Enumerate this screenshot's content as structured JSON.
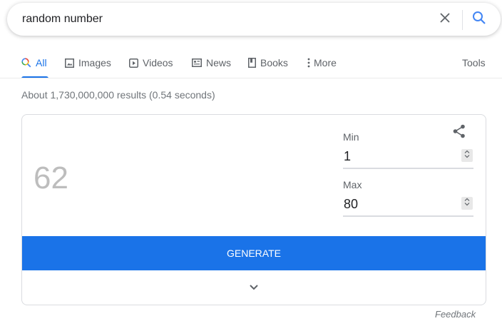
{
  "search": {
    "query": "random number",
    "clear_icon": "close-icon",
    "search_icon": "search-icon"
  },
  "tabs": [
    {
      "label": "All",
      "icon": "search-multicolor-icon",
      "active": true
    },
    {
      "label": "Images",
      "icon": "image-icon"
    },
    {
      "label": "Videos",
      "icon": "play-icon"
    },
    {
      "label": "News",
      "icon": "news-icon"
    },
    {
      "label": "Books",
      "icon": "book-icon"
    },
    {
      "label": "More",
      "icon": "more-vertical-icon"
    }
  ],
  "tools_label": "Tools",
  "stats": "About 1,730,000,000 results (0.54 seconds)",
  "generator": {
    "result": "62",
    "min_label": "Min",
    "min_value": "1",
    "max_label": "Max",
    "max_value": "80",
    "generate_label": "GENERATE",
    "share_icon": "share-icon",
    "expand_icon": "chevron-down-icon"
  },
  "feedback_label": "Feedback",
  "colors": {
    "accent": "#1a73e8",
    "result_text": "#bdbdbd",
    "muted_text": "#5f6368"
  }
}
